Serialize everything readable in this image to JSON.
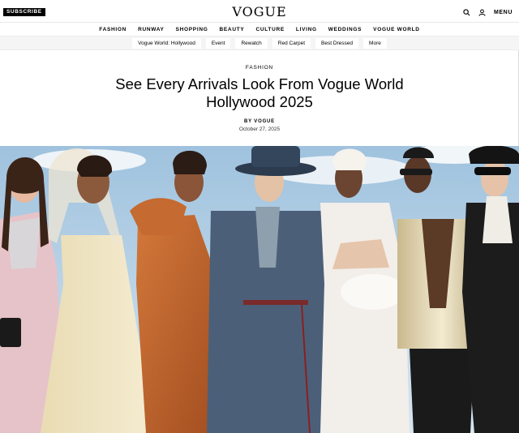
{
  "header": {
    "subscribe_label": "SUBSCRIBE",
    "logo": "VOGUE",
    "search_icon": "search-icon",
    "account_icon": "user-icon",
    "menu_label": "MENU"
  },
  "main_nav": [
    "FASHION",
    "RUNWAY",
    "SHOPPING",
    "BEAUTY",
    "CULTURE",
    "LIVING",
    "WEDDINGS",
    "VOGUE WORLD"
  ],
  "sub_nav": [
    "Vogue World: Hollywood",
    "Event",
    "Rewatch",
    "Red Carpet",
    "Best Dressed",
    "More"
  ],
  "article": {
    "kicker": "FASHION",
    "headline": "See Every Arrivals Look From Vogue World Hollywood 2025",
    "byline": "BY VOGUE",
    "date": "October 27, 2025"
  },
  "colors": {
    "sky": "#a9c9e3",
    "accent_black": "#000000"
  }
}
